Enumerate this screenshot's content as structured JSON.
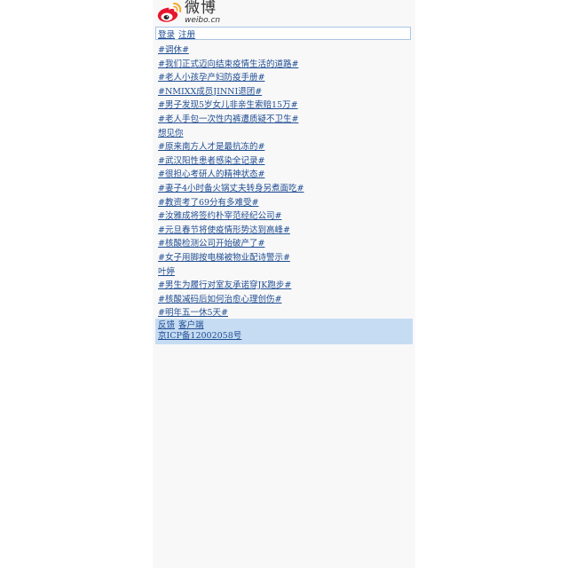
{
  "logo": {
    "name_cn": "微博",
    "name_en": "weibo.cn"
  },
  "auth": {
    "login": "登录",
    "register": "注册"
  },
  "topics": [
    "#调休#",
    "#我们正式迈向结束疫情生活的道路#",
    "#老人小孩孕产妇防疫手册#",
    "#NMIXX成员JINNI退团#",
    "#男子发现5岁女儿非亲生索赔15万#",
    "#老人手包一次性内裤遭质疑不卫生#",
    "想见你",
    "#原来南方人才是最抗冻的#",
    "#武汉阳性患者感染全记录#",
    "#很担心考研人的精神状态#",
    "#妻子4小时备火锅丈夫转身另煮面吃#",
    "#教资考了69分有多难受#",
    "#汝雅成将签约朴宰范经纪公司#",
    "#元旦春节将使疫情形势达到高峰#",
    "#核酸检测公司开始破产了#",
    "#女子用脚按电梯被物业配诗警示#",
    "叶婷",
    "#男生为履行对室友承诺穿JK跑步#",
    "#核酸减码后如何治愈心理创伤#",
    "#明年五一休5天#"
  ],
  "footer": {
    "feedback": "反馈",
    "client": "客户端",
    "icp": "京ICP备12002058号"
  },
  "colors": {
    "link": "#1f4d93",
    "footer_bg": "#c6dcf3",
    "auth_border": "#a9c6e6",
    "logo_red": "#e6162d",
    "logo_orange": "#f5a623"
  }
}
